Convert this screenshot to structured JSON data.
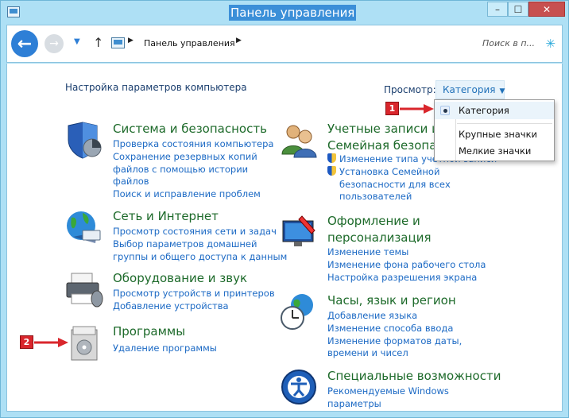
{
  "window": {
    "title": "Панель управления",
    "buttons": [
      "–",
      "☐",
      "✕"
    ]
  },
  "nav": {
    "crumb": "Панель управления",
    "search_placeholder": "Поиск в п..."
  },
  "content": {
    "heading": "Настройка параметров компьютера",
    "view_label": "Просмотр:",
    "view_value": "Категория"
  },
  "categories": [
    {
      "title": "Система и безопасность",
      "icon": "security-shield-icon",
      "links": [
        "Проверка состояния компьютера",
        "Сохранение резервных копий",
        "файлов с помощью истории",
        "файлов",
        "Поиск и исправление проблем"
      ]
    },
    {
      "title": "Сеть и Интернет",
      "icon": "network-globe-icon",
      "links": [
        "Просмотр состояния сети и задач",
        "Выбор параметров домашней",
        "группы и общего доступа к данным"
      ]
    },
    {
      "title": "Оборудование и звук",
      "icon": "printer-icon",
      "links": [
        "Просмотр устройств и принтеров",
        "Добавление устройства"
      ]
    },
    {
      "title": "Программы",
      "icon": "programs-icon",
      "links": [
        "Удаление программы"
      ]
    },
    {
      "title_lines": [
        "Учетные записи и",
        "Семейная безопа"
      ],
      "icon": "users-icon",
      "links": [
        "Изменение типа учетной записи",
        "Установка Семейной",
        "безопасности для всех",
        "пользователей"
      ]
    },
    {
      "title_lines": [
        "Оформление и",
        "персонализация"
      ],
      "icon": "appearance-icon",
      "links": [
        "Изменение темы",
        "Изменение фона рабочего стола",
        "Настройка разрешения экрана"
      ]
    },
    {
      "title": "Часы, язык и регион",
      "icon": "clock-globe-icon",
      "links": [
        "Добавление языка",
        "Изменение способа ввода",
        "Изменение форматов даты,",
        "времени и чисел"
      ]
    },
    {
      "title": "Специальные возможности",
      "icon": "accessibility-icon",
      "links": [
        "Рекомендуемые Windows",
        "параметры"
      ]
    }
  ],
  "dropdown": {
    "items": [
      "Категория",
      "Крупные значки",
      "Мелкие значки"
    ],
    "selected": "Категория"
  },
  "annotations": [
    "1",
    "2"
  ]
}
